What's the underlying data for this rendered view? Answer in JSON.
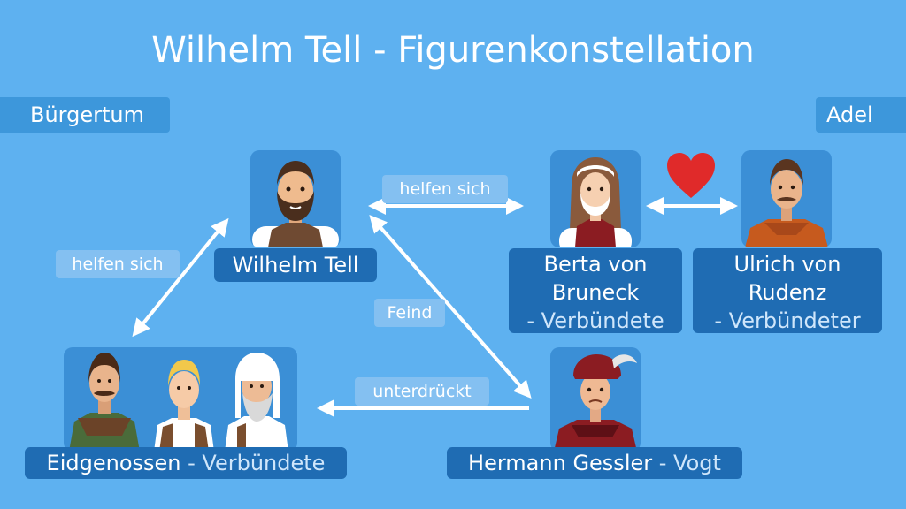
{
  "title": "Wilhelm Tell - Figurenkonstellation",
  "groups": {
    "left": "Bürgertum",
    "right": "Adel"
  },
  "characters": {
    "tell": {
      "name": "Wilhelm Tell"
    },
    "berta": {
      "name_line1": "Berta von",
      "name_line2": "Bruneck",
      "role": "- Verbündete"
    },
    "ulrich": {
      "name_line1": "Ulrich von",
      "name_line2": "Rudenz",
      "role": "- Verbündeter"
    },
    "eidgenossen": {
      "name": "Eidgenossen",
      "role": " - Verbündete"
    },
    "gessler": {
      "name": "Hermann Gessler",
      "role": " - Vogt"
    }
  },
  "relations": {
    "tell_berta": "helfen sich",
    "tell_eidgenossen": "helfen sich",
    "tell_gessler": "Feind",
    "gessler_eidgenossen": "unterdrückt"
  },
  "colors": {
    "background": "#5eb1f0",
    "label": "#1f6cb3",
    "heart": "#e02a2a"
  }
}
